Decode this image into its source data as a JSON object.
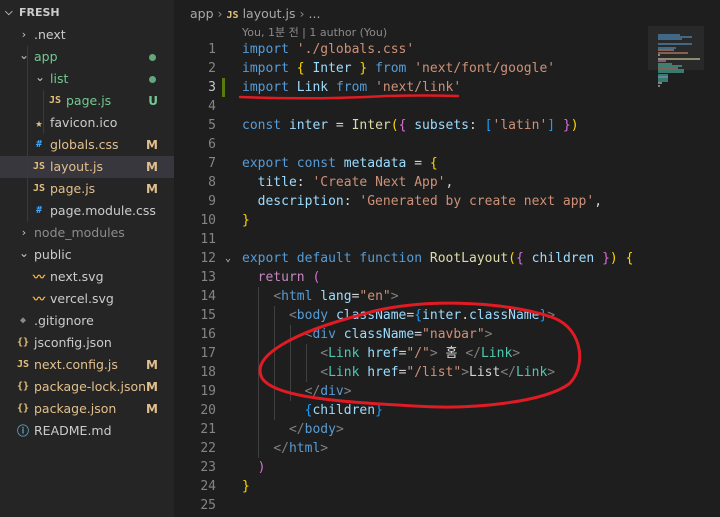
{
  "explorer": {
    "title": "FRESH",
    "items": [
      {
        "label": ".next",
        "kind": "folder-closed",
        "icon": "chevron-right-icon",
        "status": "",
        "color": "#cccccc"
      },
      {
        "label": "app",
        "kind": "folder-open",
        "icon": "chevron-down-icon",
        "status": "dot",
        "color": "#73c991"
      },
      {
        "label": "list",
        "kind": "folder-open",
        "icon": "chevron-down-icon",
        "status": "dot",
        "color": "#73c991"
      },
      {
        "label": "page.js",
        "kind": "js-file",
        "icon": "js-file-icon",
        "status": "U",
        "color": "#73c991"
      },
      {
        "label": "favicon.ico",
        "kind": "file",
        "icon": "star-icon",
        "status": "",
        "color": "#cccccc"
      },
      {
        "label": "globals.css",
        "kind": "file",
        "icon": "hash-icon",
        "status": "M",
        "color": "#e2c08d"
      },
      {
        "label": "layout.js",
        "kind": "js-file",
        "icon": "js-file-icon",
        "status": "M",
        "color": "#e2c08d"
      },
      {
        "label": "page.js",
        "kind": "js-file",
        "icon": "js-file-icon",
        "status": "M",
        "color": "#e2c08d"
      },
      {
        "label": "page.module.css",
        "kind": "file",
        "icon": "hash-icon",
        "status": "",
        "color": "#cccccc"
      },
      {
        "label": "node_modules",
        "kind": "folder-closed",
        "icon": "chevron-right-icon",
        "status": "",
        "color": "#8c8c8c"
      },
      {
        "label": "public",
        "kind": "folder-open",
        "icon": "chevron-down-icon",
        "status": "",
        "color": "#cccccc"
      },
      {
        "label": "next.svg",
        "kind": "file",
        "icon": "svg-file-icon",
        "status": "",
        "color": "#cccccc"
      },
      {
        "label": "vercel.svg",
        "kind": "file",
        "icon": "svg-file-icon",
        "status": "",
        "color": "#cccccc"
      },
      {
        "label": ".gitignore",
        "kind": "file",
        "icon": "git-icon",
        "status": "",
        "color": "#cccccc"
      },
      {
        "label": "jsconfig.json",
        "kind": "file",
        "icon": "json-file-icon",
        "status": "",
        "color": "#cccccc"
      },
      {
        "label": "next.config.js",
        "kind": "js-file",
        "icon": "js-file-icon",
        "status": "M",
        "color": "#e2c08d"
      },
      {
        "label": "package-lock.json",
        "kind": "file",
        "icon": "json-file-icon",
        "status": "M",
        "color": "#e2c08d"
      },
      {
        "label": "package.json",
        "kind": "file",
        "icon": "json-file-icon",
        "status": "M",
        "color": "#e2c08d"
      },
      {
        "label": "README.md",
        "kind": "file",
        "icon": "info-icon",
        "status": "",
        "color": "#cccccc"
      }
    ]
  },
  "editor": {
    "breadcrumb": {
      "folder": "app",
      "file_icon": "JS",
      "file": "layout.js",
      "ellipsis": "..."
    },
    "blame": "You, 1분 전 | 1 author (You)",
    "line_numbers": [
      "1",
      "2",
      "3",
      "4",
      "5",
      "6",
      "7",
      "8",
      "9",
      "10",
      "11",
      "12",
      "13",
      "14",
      "15",
      "16",
      "17",
      "18",
      "19",
      "20",
      "21",
      "22",
      "23",
      "24",
      "25"
    ],
    "lines": [
      [
        [
          "tk-kw",
          "import"
        ],
        [
          "tk-plain",
          " "
        ],
        [
          "tk-str",
          "'./globals.css'"
        ]
      ],
      [
        [
          "tk-kw",
          "import"
        ],
        [
          "tk-plain",
          " "
        ],
        [
          "tk-br1",
          "{"
        ],
        [
          "tk-plain",
          " "
        ],
        [
          "tk-var",
          "Inter"
        ],
        [
          "tk-plain",
          " "
        ],
        [
          "tk-br1",
          "}"
        ],
        [
          "tk-plain",
          " "
        ],
        [
          "tk-kw",
          "from"
        ],
        [
          "tk-plain",
          " "
        ],
        [
          "tk-str",
          "'next/font/google'"
        ]
      ],
      [
        [
          "tk-kw",
          "import"
        ],
        [
          "tk-plain",
          " "
        ],
        [
          "tk-var",
          "Link"
        ],
        [
          "tk-plain",
          " "
        ],
        [
          "tk-kw",
          "from"
        ],
        [
          "tk-plain",
          " "
        ],
        [
          "tk-str",
          "'next/link'"
        ]
      ],
      [],
      [
        [
          "tk-kw",
          "const"
        ],
        [
          "tk-plain",
          " "
        ],
        [
          "tk-var",
          "inter"
        ],
        [
          "tk-plain",
          " = "
        ],
        [
          "tk-fn",
          "Inter"
        ],
        [
          "tk-br1",
          "("
        ],
        [
          "tk-br2",
          "{"
        ],
        [
          "tk-plain",
          " "
        ],
        [
          "tk-var",
          "subsets"
        ],
        [
          "tk-plain",
          ": "
        ],
        [
          "tk-br3",
          "["
        ],
        [
          "tk-str",
          "'latin'"
        ],
        [
          "tk-br3",
          "]"
        ],
        [
          "tk-plain",
          " "
        ],
        [
          "tk-br2",
          "}"
        ],
        [
          "tk-br1",
          ")"
        ]
      ],
      [],
      [
        [
          "tk-kw",
          "export"
        ],
        [
          "tk-plain",
          " "
        ],
        [
          "tk-kw",
          "const"
        ],
        [
          "tk-plain",
          " "
        ],
        [
          "tk-var",
          "metadata"
        ],
        [
          "tk-plain",
          " = "
        ],
        [
          "tk-br1",
          "{"
        ]
      ],
      [
        [
          "tk-plain",
          "  "
        ],
        [
          "tk-var",
          "title"
        ],
        [
          "tk-plain",
          ": "
        ],
        [
          "tk-str",
          "'Create Next App'"
        ],
        [
          "tk-plain",
          ","
        ]
      ],
      [
        [
          "tk-plain",
          "  "
        ],
        [
          "tk-var",
          "description"
        ],
        [
          "tk-plain",
          ": "
        ],
        [
          "tk-str",
          "'Generated by create next app'"
        ],
        [
          "tk-plain",
          ","
        ]
      ],
      [
        [
          "tk-br1",
          "}"
        ]
      ],
      [],
      [
        [
          "tk-kw",
          "export"
        ],
        [
          "tk-plain",
          " "
        ],
        [
          "tk-kw",
          "default"
        ],
        [
          "tk-plain",
          " "
        ],
        [
          "tk-kw",
          "function"
        ],
        [
          "tk-plain",
          " "
        ],
        [
          "tk-fn",
          "RootLayout"
        ],
        [
          "tk-br1",
          "("
        ],
        [
          "tk-br2",
          "{"
        ],
        [
          "tk-plain",
          " "
        ],
        [
          "tk-var",
          "children"
        ],
        [
          "tk-plain",
          " "
        ],
        [
          "tk-br2",
          "}"
        ],
        [
          "tk-br1",
          ")"
        ],
        [
          "tk-plain",
          " "
        ],
        [
          "tk-br1",
          "{"
        ]
      ],
      [
        [
          "tk-plain",
          "  "
        ],
        [
          "tk-ctl",
          "return"
        ],
        [
          "tk-plain",
          " "
        ],
        [
          "tk-br2",
          "("
        ]
      ],
      [
        [
          "tk-plain",
          "    "
        ],
        [
          "tk-pun",
          "<"
        ],
        [
          "tk-html",
          "html"
        ],
        [
          "tk-plain",
          " "
        ],
        [
          "tk-attr",
          "lang"
        ],
        [
          "tk-plain",
          "="
        ],
        [
          "tk-str",
          "\"en\""
        ],
        [
          "tk-pun",
          ">"
        ]
      ],
      [
        [
          "tk-plain",
          "      "
        ],
        [
          "tk-pun",
          "<"
        ],
        [
          "tk-html",
          "body"
        ],
        [
          "tk-plain",
          " "
        ],
        [
          "tk-attr",
          "className"
        ],
        [
          "tk-plain",
          "="
        ],
        [
          "tk-br3",
          "{"
        ],
        [
          "tk-var",
          "inter"
        ],
        [
          "tk-plain",
          "."
        ],
        [
          "tk-var",
          "className"
        ],
        [
          "tk-br3",
          "}"
        ],
        [
          "tk-pun",
          ">"
        ]
      ],
      [
        [
          "tk-plain",
          "        "
        ],
        [
          "tk-pun",
          "<"
        ],
        [
          "tk-html",
          "div"
        ],
        [
          "tk-plain",
          " "
        ],
        [
          "tk-attr",
          "className"
        ],
        [
          "tk-plain",
          "="
        ],
        [
          "tk-str",
          "\"navbar\""
        ],
        [
          "tk-pun",
          ">"
        ]
      ],
      [
        [
          "tk-plain",
          "          "
        ],
        [
          "tk-pun",
          "<"
        ],
        [
          "tk-tag",
          "Link"
        ],
        [
          "tk-plain",
          " "
        ],
        [
          "tk-attr",
          "href"
        ],
        [
          "tk-plain",
          "="
        ],
        [
          "tk-str",
          "\"/\""
        ],
        [
          "tk-pun",
          ">"
        ],
        [
          "tk-plain",
          " 홈 "
        ],
        [
          "tk-pun",
          "</"
        ],
        [
          "tk-tag",
          "Link"
        ],
        [
          "tk-pun",
          ">"
        ]
      ],
      [
        [
          "tk-plain",
          "          "
        ],
        [
          "tk-pun",
          "<"
        ],
        [
          "tk-tag",
          "Link"
        ],
        [
          "tk-plain",
          " "
        ],
        [
          "tk-attr",
          "href"
        ],
        [
          "tk-plain",
          "="
        ],
        [
          "tk-str",
          "\"/list\""
        ],
        [
          "tk-pun",
          ">"
        ],
        [
          "tk-plain",
          "List"
        ],
        [
          "tk-pun",
          "</"
        ],
        [
          "tk-tag",
          "Link"
        ],
        [
          "tk-pun",
          ">"
        ]
      ],
      [
        [
          "tk-plain",
          "        "
        ],
        [
          "tk-pun",
          "</"
        ],
        [
          "tk-html",
          "div"
        ],
        [
          "tk-pun",
          ">"
        ]
      ],
      [
        [
          "tk-plain",
          "        "
        ],
        [
          "tk-br3",
          "{"
        ],
        [
          "tk-var",
          "children"
        ],
        [
          "tk-br3",
          "}"
        ]
      ],
      [
        [
          "tk-plain",
          "      "
        ],
        [
          "tk-pun",
          "</"
        ],
        [
          "tk-html",
          "body"
        ],
        [
          "tk-pun",
          ">"
        ]
      ],
      [
        [
          "tk-plain",
          "    "
        ],
        [
          "tk-pun",
          "</"
        ],
        [
          "tk-html",
          "html"
        ],
        [
          "tk-pun",
          ">"
        ]
      ],
      [
        [
          "tk-plain",
          "  "
        ],
        [
          "tk-br2",
          ")"
        ]
      ],
      [
        [
          "tk-br1",
          "}"
        ]
      ],
      []
    ]
  },
  "colors": {
    "accent_annotation": "#e01b24",
    "modified": "#e2c08d",
    "untracked": "#73c991",
    "added_gutter": "#587c0c"
  }
}
